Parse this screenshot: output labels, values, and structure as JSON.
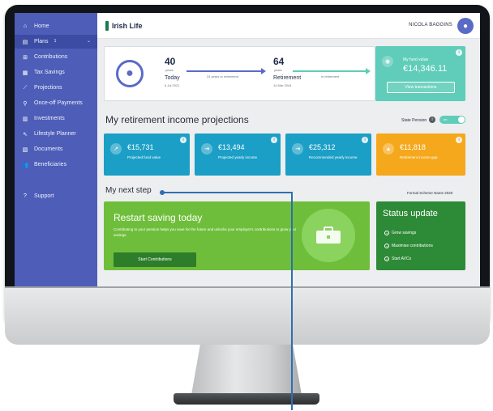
{
  "sidebar": {
    "items": [
      {
        "label": "Home",
        "icon": "home-icon",
        "glyph": "⌂"
      },
      {
        "label": "Plans",
        "icon": "plans-icon",
        "glyph": "▤",
        "count": "1"
      },
      {
        "label": "Contributions",
        "icon": "contributions-icon",
        "glyph": "⊞"
      },
      {
        "label": "Tax Savings",
        "icon": "tax-savings-icon",
        "glyph": "▦"
      },
      {
        "label": "Projections",
        "icon": "projections-icon",
        "glyph": "⟋"
      },
      {
        "label": "Once-off Payments",
        "icon": "once-off-payments-icon",
        "glyph": "⚲"
      },
      {
        "label": "Investments",
        "icon": "investments-icon",
        "glyph": "▥"
      },
      {
        "label": "Lifestyle Planner",
        "icon": "lifestyle-planner-icon",
        "glyph": "⇖"
      },
      {
        "label": "Documents",
        "icon": "documents-icon",
        "glyph": "▧"
      },
      {
        "label": "Beneficiaries",
        "icon": "beneficiaries-icon",
        "glyph": "👥"
      },
      {
        "label": "Support",
        "icon": "support-icon",
        "glyph": "?"
      }
    ]
  },
  "header": {
    "brand": "Irish Life",
    "user_name": "NICOLA BAGGINS"
  },
  "timeline": {
    "current_age": "40",
    "current_unit": "years",
    "current_label": "Today",
    "current_date": "6 Jul 2021",
    "gap_text": "24 years to retirement",
    "retire_age": "64",
    "retire_unit": "years",
    "retire_label": "Retirement",
    "retire_date": "14 Mar 2044",
    "after_text": "in retirement"
  },
  "fund": {
    "label": "My fund value",
    "value": "€14,346.11",
    "button": "View transactions"
  },
  "projections": {
    "title": "My retirement income projections",
    "state_pension_label": "State Pension",
    "toggle_text": "on",
    "cards": [
      {
        "value": "€15,731",
        "label": "Projected fund value",
        "color": "#1b9fc6"
      },
      {
        "value": "€13,494",
        "label": "Projected yearly income",
        "color": "#1b9fc6"
      },
      {
        "value": "€25,312",
        "label": "Recommended yearly income",
        "color": "#1b9fc6"
      },
      {
        "value": "€11,818",
        "label": "Retirement income gap",
        "color": "#f5a81c"
      }
    ]
  },
  "next_step": {
    "title": "My next step",
    "scheme_name": "Formal Scheme Name 2020",
    "heading": "Restart saving today",
    "body": "Contributing to your pension helps you save for the future and unlocks your employer's contributions to grow your savings.",
    "button": "Start Contributions"
  },
  "status": {
    "heading": "Status update",
    "items": [
      "Grow savings",
      "Maximise contributions",
      "Start AVCs"
    ]
  },
  "colors": {
    "sidebar": "#4d5db8",
    "teal": "#5fcdb9",
    "blue_card": "#1b9fc6",
    "orange_card": "#f5a81c",
    "green_card": "#6fbe3b",
    "dark_green_card": "#2d8a36",
    "callout": "#2f6fb0"
  }
}
